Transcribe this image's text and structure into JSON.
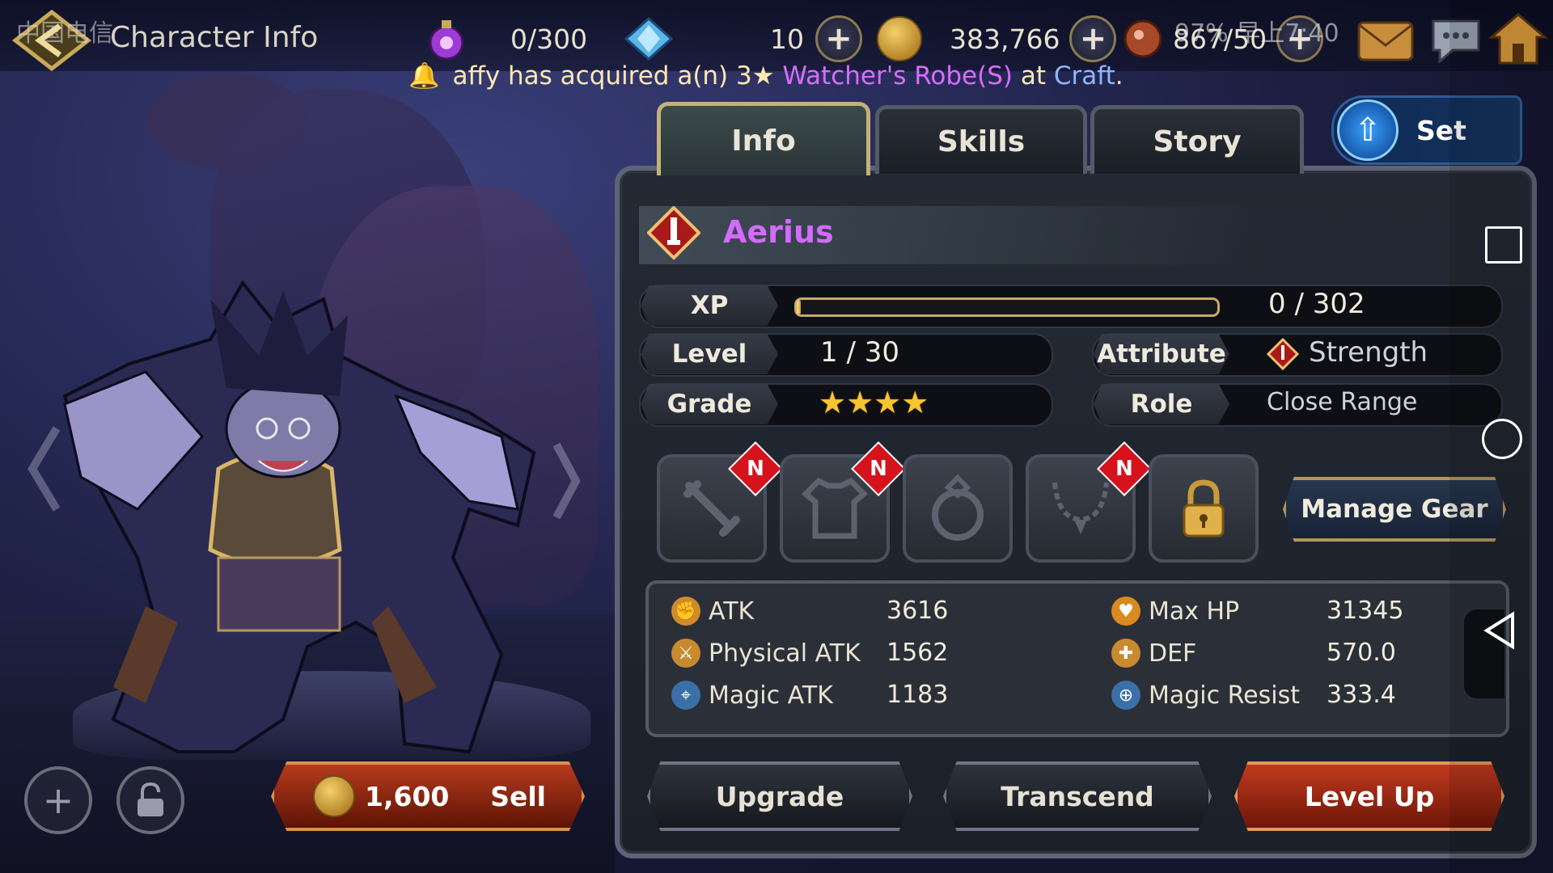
{
  "status": {
    "carrier": "中国电信",
    "system": "97%  早上7:40"
  },
  "header": {
    "title": "Character Info"
  },
  "resources": {
    "potion": "0/300",
    "crystal": "10",
    "gold": "383,766",
    "stamina": "867/50"
  },
  "notice": {
    "user": "affy",
    "mid": " has acquired a(n) 3★ ",
    "item": "Watcher's Robe(S)",
    "at": " at ",
    "place": "Craft",
    "end": "."
  },
  "tabs": {
    "info": "Info",
    "skills": "Skills",
    "story": "Story",
    "set": "Set"
  },
  "hero": {
    "name": "Aerius"
  },
  "info": {
    "xp_label": "XP",
    "xp_value": "0 / 302",
    "xp_progress": 0.0,
    "level_label": "Level",
    "level_value": "1 / 30",
    "attribute_label": "Attribute",
    "attribute_value": "Strength",
    "grade_label": "Grade",
    "grade_stars": 4,
    "role_label": "Role",
    "role_value": "Close Range"
  },
  "gear": {
    "badge": "N",
    "manage_label": "Manage Gear"
  },
  "stats": {
    "atk_label": "ATK",
    "atk": "3616",
    "patk_label": "Physical ATK",
    "patk": "1562",
    "matk_label": "Magic ATK",
    "matk": "1183",
    "hp_label": "Max HP",
    "hp": "31345",
    "def_label": "DEF",
    "def": "570.0",
    "mres_label": "Magic Resist",
    "mres": "333.4"
  },
  "actions": {
    "sell_price": "1,600",
    "sell_label": "Sell",
    "upgrade": "Upgrade",
    "transcend": "Transcend",
    "levelup": "Level Up"
  },
  "colors": {
    "name": "#d46bff",
    "accent_gold": "#c8a96a",
    "levelup": "#c03a1e"
  }
}
